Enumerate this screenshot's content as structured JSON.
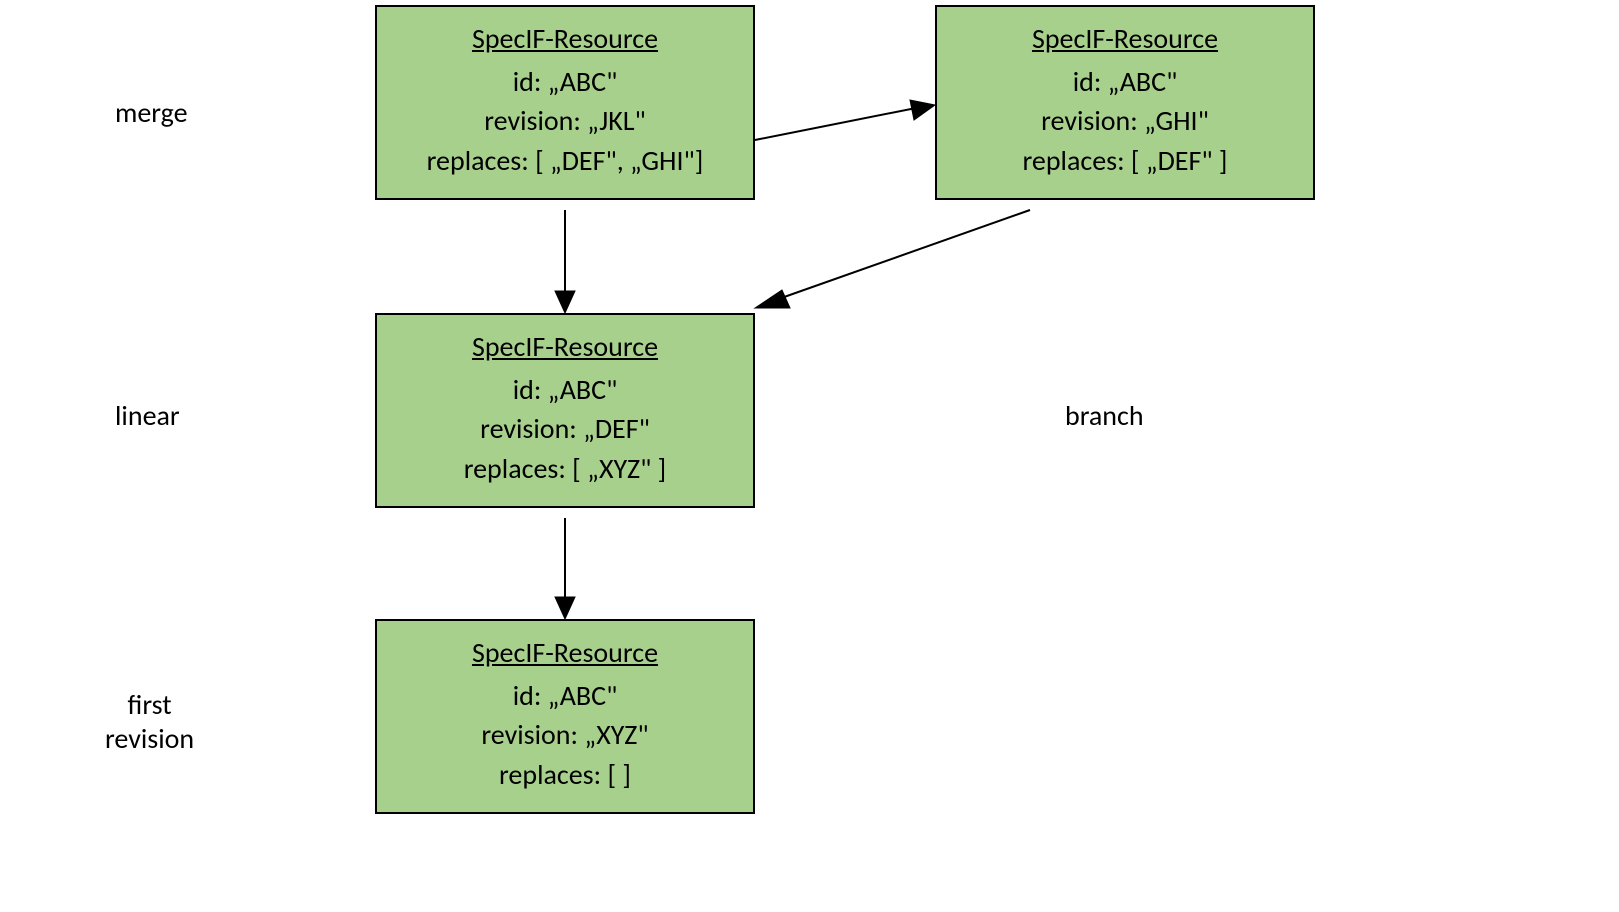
{
  "labels": {
    "resource_title": "SpecIF-Resource",
    "branch": "branch",
    "merge": "merge",
    "linear": "linear",
    "first": "first\nrevision"
  },
  "boxes": {
    "jkl": {
      "id_line": "id: „ABC\"",
      "rev_line": "revision: „JKL\"",
      "rep_line": "replaces: [ „DEF\", „GHI\"]"
    },
    "ghi": {
      "id_line": "id: „ABC\"",
      "rev_line": "revision: „GHI\"",
      "rep_line": "replaces: [ „DEF\" ]"
    },
    "def": {
      "id_line": "id: „ABC\"",
      "rev_line": "revision: „DEF\"",
      "rep_line": "replaces: [ „XYZ\" ]"
    },
    "xyz": {
      "id_line": "id: „ABC\"",
      "rev_line": "revision: „XYZ\"",
      "rep_line": "replaces: [ ]"
    }
  }
}
